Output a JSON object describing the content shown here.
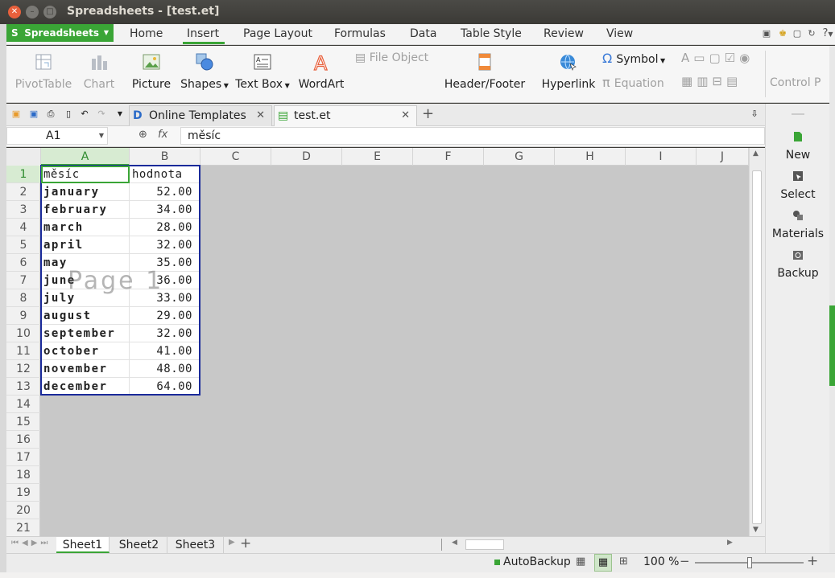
{
  "window": {
    "title": "Spreadsheets - [test.et]"
  },
  "menubar": {
    "app_button": "Spreadsheets",
    "items": [
      "Home",
      "Insert",
      "Page Layout",
      "Formulas",
      "Data",
      "Table Style",
      "Review",
      "View"
    ],
    "active": "Insert",
    "help": "?"
  },
  "ribbon": {
    "pivot": "PivotTable",
    "chart": "Chart",
    "picture": "Picture",
    "shapes": "Shapes",
    "textbox": "Text Box",
    "wordart": "WordArt",
    "file_object": "File Object",
    "header_footer": "Header/Footer",
    "hyperlink": "Hyperlink",
    "symbol": "Symbol",
    "equation": "Equation",
    "control": "Control P"
  },
  "tabs": [
    {
      "label": "Online Templates"
    },
    {
      "label": "test.et"
    }
  ],
  "formula_bar": {
    "cell_ref": "A1",
    "fx": "fx",
    "value": "měsíc"
  },
  "columns": [
    "A",
    "B",
    "C",
    "D",
    "E",
    "F",
    "G",
    "H",
    "I",
    "J"
  ],
  "rows": [
    "1",
    "2",
    "3",
    "4",
    "5",
    "6",
    "7",
    "8",
    "9",
    "10",
    "11",
    "12",
    "13",
    "14",
    "15",
    "16",
    "17",
    "18",
    "19",
    "20",
    "21"
  ],
  "table": {
    "header": {
      "a": "měsíc",
      "b": "hodnota"
    },
    "data": [
      {
        "a": "january",
        "b": "52.00"
      },
      {
        "a": "february",
        "b": "34.00"
      },
      {
        "a": "march",
        "b": "28.00"
      },
      {
        "a": "april",
        "b": "32.00"
      },
      {
        "a": "may",
        "b": "35.00"
      },
      {
        "a": "june",
        "b": "36.00"
      },
      {
        "a": "july",
        "b": "33.00"
      },
      {
        "a": "august",
        "b": "29.00"
      },
      {
        "a": "september",
        "b": "32.00"
      },
      {
        "a": "october",
        "b": "41.00"
      },
      {
        "a": "november",
        "b": "48.00"
      },
      {
        "a": "december",
        "b": "64.00"
      }
    ]
  },
  "page_watermark": "Page 1",
  "sheets": [
    "Sheet1",
    "Sheet2",
    "Sheet3"
  ],
  "status": {
    "autobackup": "AutoBackup",
    "zoom": "100 %",
    "zoom_percent": 100
  },
  "side_panel": {
    "new": "New",
    "select": "Select",
    "materials": "Materials",
    "backup": "Backup"
  },
  "colors": {
    "accent": "#3aa536",
    "page_border": "#1a2a9a",
    "wordart": "#e8603c"
  }
}
